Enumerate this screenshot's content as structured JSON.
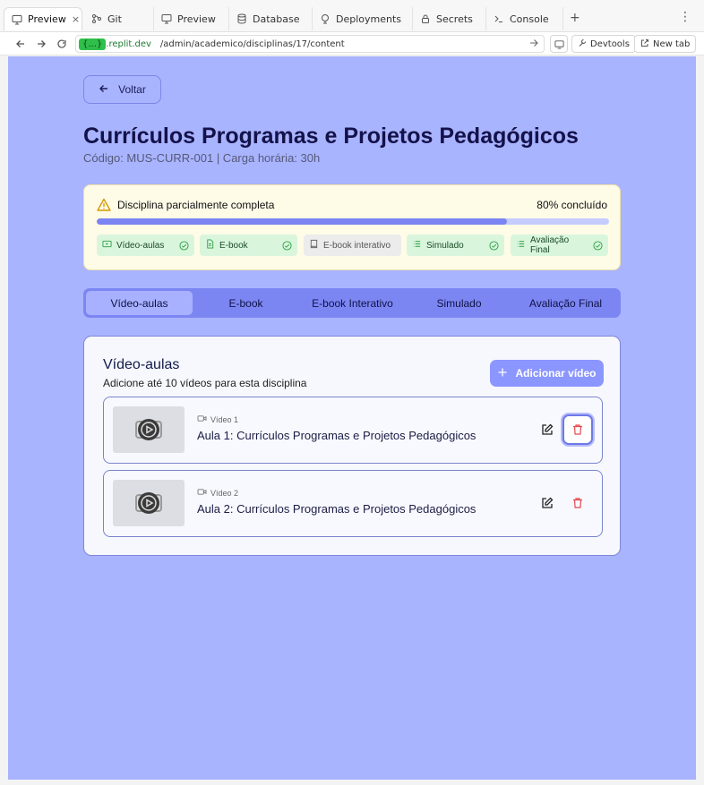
{
  "browser": {
    "tabs": [
      {
        "label": "Preview",
        "icon": "monitor-icon",
        "active": true
      },
      {
        "label": "Git",
        "icon": "git-icon"
      },
      {
        "label": "Preview",
        "icon": "monitor-icon"
      },
      {
        "label": "Database",
        "icon": "database-icon"
      },
      {
        "label": "Deployments",
        "icon": "deploy-icon"
      },
      {
        "label": "Secrets",
        "icon": "lock-icon"
      },
      {
        "label": "Console",
        "icon": "terminal-icon"
      }
    ],
    "close_label": "×",
    "new_tab_symbol": "+",
    "menu_symbol": "⋮",
    "url_host_badge": "{...}",
    "url_host": ".replit.dev",
    "url_path": "/admin/academico/disciplinas/17/content",
    "devtools_label": "Devtools",
    "newtab_label": "New tab"
  },
  "page": {
    "back_label": "Voltar",
    "title": "Currículos Programas e Projetos Pedagógicos",
    "subtitle": "Código: MUS-CURR-001 | Carga horária: 30h",
    "status": {
      "label": "Disciplina parcialmente completa",
      "percent_text": "80% concluído",
      "progress": 0.8,
      "chips": [
        {
          "label": "Vídeo-aulas",
          "icon": "video-icon",
          "complete": true
        },
        {
          "label": "E-book",
          "icon": "file-icon",
          "complete": true
        },
        {
          "label": "E-book interativo",
          "icon": "book-icon",
          "complete": false
        },
        {
          "label": "Simulado",
          "icon": "list-icon",
          "complete": true
        },
        {
          "label": "Avaliação Final",
          "icon": "list-icon",
          "complete": true
        }
      ]
    },
    "tabs": [
      "Vídeo-aulas",
      "E-book",
      "E-book Interativo",
      "Simulado",
      "Avaliação Final"
    ],
    "active_tab": "Vídeo-aulas",
    "section": {
      "heading": "Vídeo-aulas",
      "description": "Adicione até 10 vídeos para esta disciplina",
      "add_label": "Adicionar vídeo",
      "videos": [
        {
          "index_label": "Vídeo 1",
          "title": "Aula 1: Currículos Programas e Projetos Pedagógicos"
        },
        {
          "index_label": "Vídeo 2",
          "title": "Aula 2: Currículos Programas e Projetos Pedagógicos"
        }
      ]
    }
  },
  "colors": {
    "page_bg": "#a9b4ff",
    "accent": "#8c96ff",
    "delete_red": "#e5484d",
    "success_green": "#2f9e44"
  }
}
